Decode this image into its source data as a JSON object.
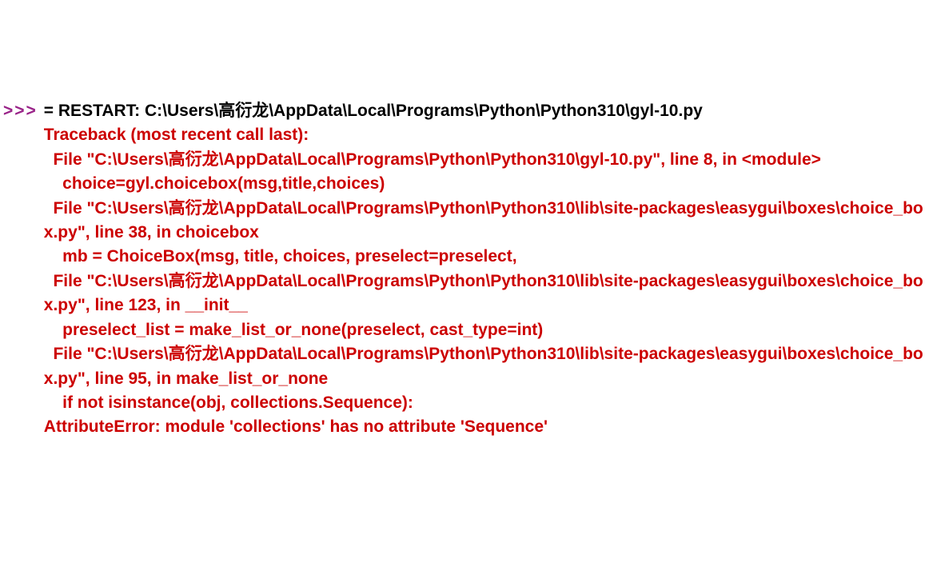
{
  "prompt": ">>>",
  "restart_line": "= RESTART: C:\\Users\\高衍龙\\AppData\\Local\\Programs\\Python\\Python310\\gyl-10.py",
  "traceback": {
    "header": "Traceback (most recent call last):",
    "frame1_location": "  File \"C:\\Users\\高衍龙\\AppData\\Local\\Programs\\Python\\Python310\\gyl-10.py\", line 8, in <module>",
    "frame1_code": "    choice=gyl.choicebox(msg,title,choices)",
    "frame2_location": "  File \"C:\\Users\\高衍龙\\AppData\\Local\\Programs\\Python\\Python310\\lib\\site-packages\\easygui\\boxes\\choice_box.py\", line 38, in choicebox",
    "frame2_code": "    mb = ChoiceBox(msg, title, choices, preselect=preselect,",
    "frame3_location": "  File \"C:\\Users\\高衍龙\\AppData\\Local\\Programs\\Python\\Python310\\lib\\site-packages\\easygui\\boxes\\choice_box.py\", line 123, in __init__",
    "frame3_code": "    preselect_list = make_list_or_none(preselect, cast_type=int)",
    "frame4_location": "  File \"C:\\Users\\高衍龙\\AppData\\Local\\Programs\\Python\\Python310\\lib\\site-packages\\easygui\\boxes\\choice_box.py\", line 95, in make_list_or_none",
    "frame4_code": "    if not isinstance(obj, collections.Sequence):",
    "error": "AttributeError: module 'collections' has no attribute 'Sequence'"
  }
}
